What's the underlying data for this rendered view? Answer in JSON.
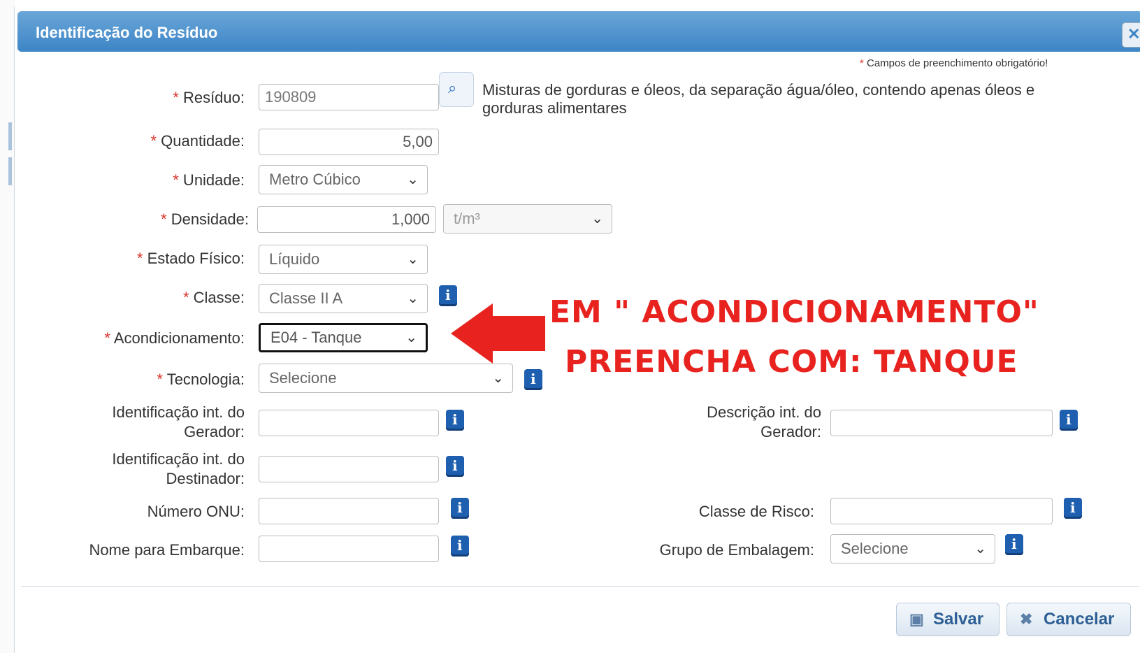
{
  "dialog": {
    "title": "Identificação do Resíduo",
    "close_icon": "close-icon"
  },
  "required_note": {
    "star": "*",
    "text": " Campos de preenchimento obrigatório!"
  },
  "fields": {
    "residuo": {
      "star": "*",
      "label": " Resíduo:",
      "value": "190809",
      "description": "Misturas de gorduras e óleos, da separação água/óleo, contendo apenas óleos e gorduras alimentares"
    },
    "quantidade": {
      "star": "*",
      "label": " Quantidade:",
      "value": "5,00"
    },
    "unidade": {
      "star": "*",
      "label": " Unidade:",
      "value": "Metro Cúbico"
    },
    "densidade": {
      "star": "*",
      "label": " Densidade:",
      "value": "1,000",
      "unit": "t/m³"
    },
    "estado_fisico": {
      "star": "*",
      "label": " Estado Físico:",
      "value": "Líquido"
    },
    "classe": {
      "star": "*",
      "label": " Classe:",
      "value": "Classe II A"
    },
    "acondicionamento": {
      "star": "*",
      "label": " Acondicionamento:",
      "value": "E04 - Tanque"
    },
    "tecnologia": {
      "star": "*",
      "label": " Tecnologia:",
      "value": "Selecione"
    },
    "id_gerador": {
      "label1": "Identificação int. do",
      "label2": "Gerador:",
      "value": ""
    },
    "desc_gerador": {
      "label1": "Descrição int. do",
      "label2": "Gerador:",
      "value": ""
    },
    "id_destinador": {
      "label1": "Identificação int. do",
      "label2": "Destinador:",
      "value": ""
    },
    "numero_onu": {
      "label": "Número ONU:",
      "value": ""
    },
    "classe_risco": {
      "label": "Classe de Risco:",
      "value": ""
    },
    "nome_embarque": {
      "label": "Nome para Embarque:",
      "value": ""
    },
    "grupo_embalagem": {
      "label": "Grupo de Embalagem:",
      "value": "Selecione"
    }
  },
  "annotation": {
    "line1": "EM \" ACONDICIONAMENTO\"",
    "line2": "PREENCHA COM: TANQUE",
    "color": "#e8231f"
  },
  "buttons": {
    "save": "Salvar",
    "cancel": "Cancelar"
  },
  "colors": {
    "title_bar": "#3d85c6",
    "required": "#d9342b",
    "info_icon": "#1f5fb0"
  }
}
